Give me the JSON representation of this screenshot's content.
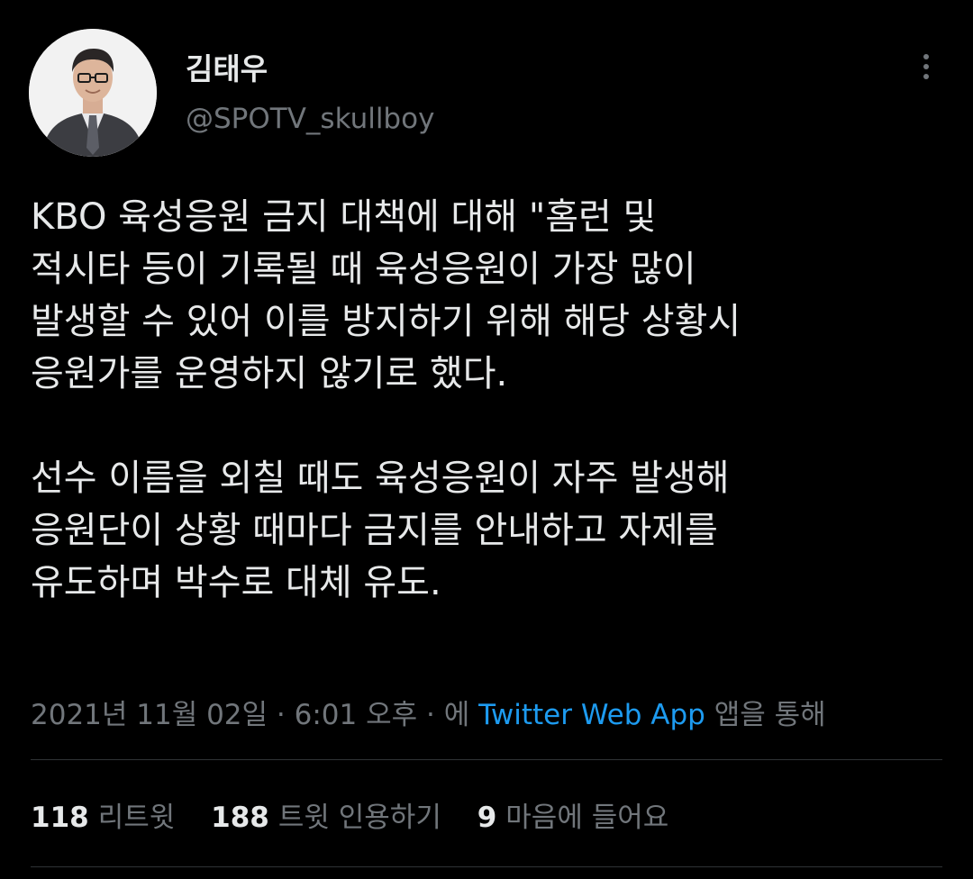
{
  "author": {
    "display_name": "김태우",
    "handle": "@SPOTV_skullboy"
  },
  "tweet": {
    "paragraphs": [
      {
        "lines": [
          "KBO 육성응원 금지 대책에 대해 \"홈런 및",
          "적시타 등이 기록될 때 육성응원이 가장 많이",
          "발생할 수 있어 이를 방지하기 위해 해당 상황시",
          "응원가를 운영하지 않기로 했다."
        ]
      },
      {
        "lines": [
          "선수 이름을 외칠 때도 육성응원이 자주 발생해",
          "응원단이 상황 때마다 금지를 안내하고 자제를",
          "유도하며 박수로 대체 유도."
        ]
      }
    ]
  },
  "meta": {
    "date": "2021년 11월 02일",
    "sep1": " · ",
    "time": "6:01 오후",
    "sep2": " · ",
    "via_prefix": "에 ",
    "source": "Twitter Web App",
    "via_suffix": " 앱을 통해"
  },
  "stats": {
    "retweets": {
      "count": "118",
      "label": "리트윗"
    },
    "quotes": {
      "count": "188",
      "label": "트윗 인용하기"
    },
    "likes": {
      "count": "9",
      "label": "마음에 들어요"
    }
  },
  "icons": {
    "more": "more-vertical-icon"
  },
  "colors": {
    "background": "#000000",
    "text": "#e7e9ea",
    "secondary": "#71767b",
    "link": "#1d9bf0",
    "divider": "#2f3336"
  }
}
